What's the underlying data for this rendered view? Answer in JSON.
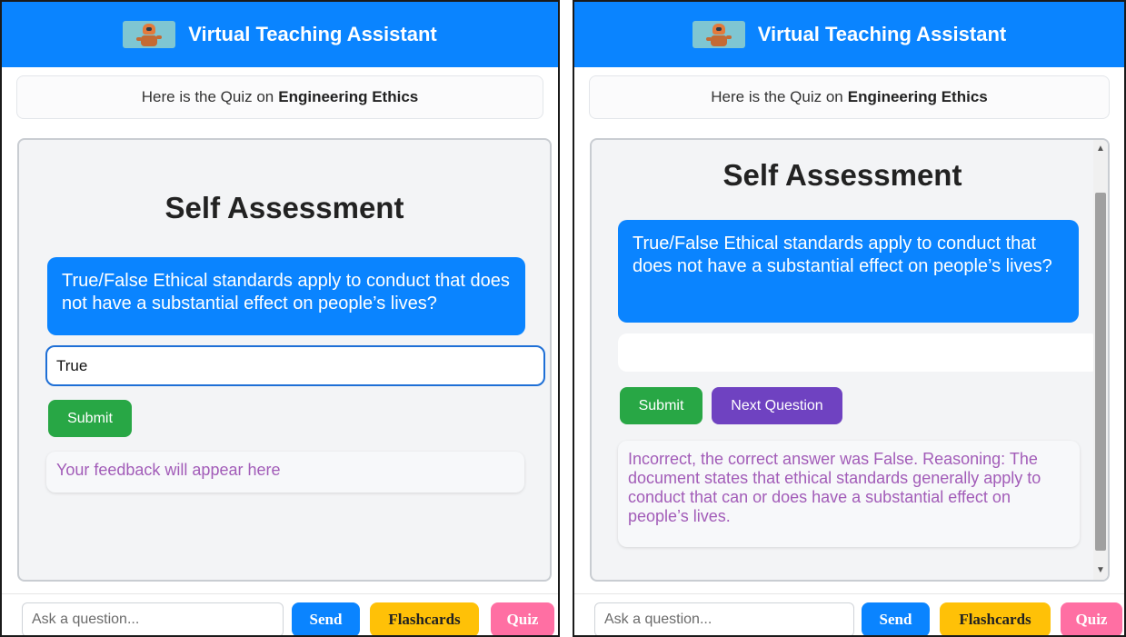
{
  "colors": {
    "header": "#0a84ff",
    "question_bubble": "#0a84ff",
    "submit": "#28a745",
    "next_question": "#6f42c1",
    "feedback_text": "#a25cb8",
    "send": "#0a84ff",
    "flashcards": "#ffc107",
    "quiz": "#ff6fa3"
  },
  "left": {
    "header": {
      "title": "Virtual Teaching Assistant",
      "logo_icon": "robot-icon"
    },
    "banner": {
      "prefix": "Here is the Quiz on",
      "topic": "Engineering Ethics"
    },
    "quiz": {
      "title": "Self Assessment",
      "question": "True/False Ethical standards apply to conduct that does not have a substantial effect on people’s lives?",
      "answer_value": "True",
      "submit_label": "Submit",
      "feedback": "Your feedback will appear here"
    },
    "footer": {
      "ask_placeholder": "Ask a question...",
      "send_label": "Send",
      "flashcards_label": "Flashcards",
      "quiz_label": "Quiz"
    }
  },
  "right": {
    "header": {
      "title": "Virtual Teaching Assistant",
      "logo_icon": "robot-icon"
    },
    "banner": {
      "prefix": "Here is the Quiz on",
      "topic": "Engineering Ethics"
    },
    "quiz": {
      "title": "Self Assessment",
      "question": "True/False Ethical standards apply to conduct that does not have a substantial effect on people’s lives?",
      "answer_value": "",
      "submit_label": "Submit",
      "next_label": "Next Question",
      "feedback": "Incorrect, the correct answer was False. Reasoning: The document states that ethical standards generally apply to conduct that can or does have a substantial effect on people’s lives."
    },
    "footer": {
      "ask_placeholder": "Ask a question...",
      "send_label": "Send",
      "flashcards_label": "Flashcards",
      "quiz_label": "Quiz"
    }
  }
}
